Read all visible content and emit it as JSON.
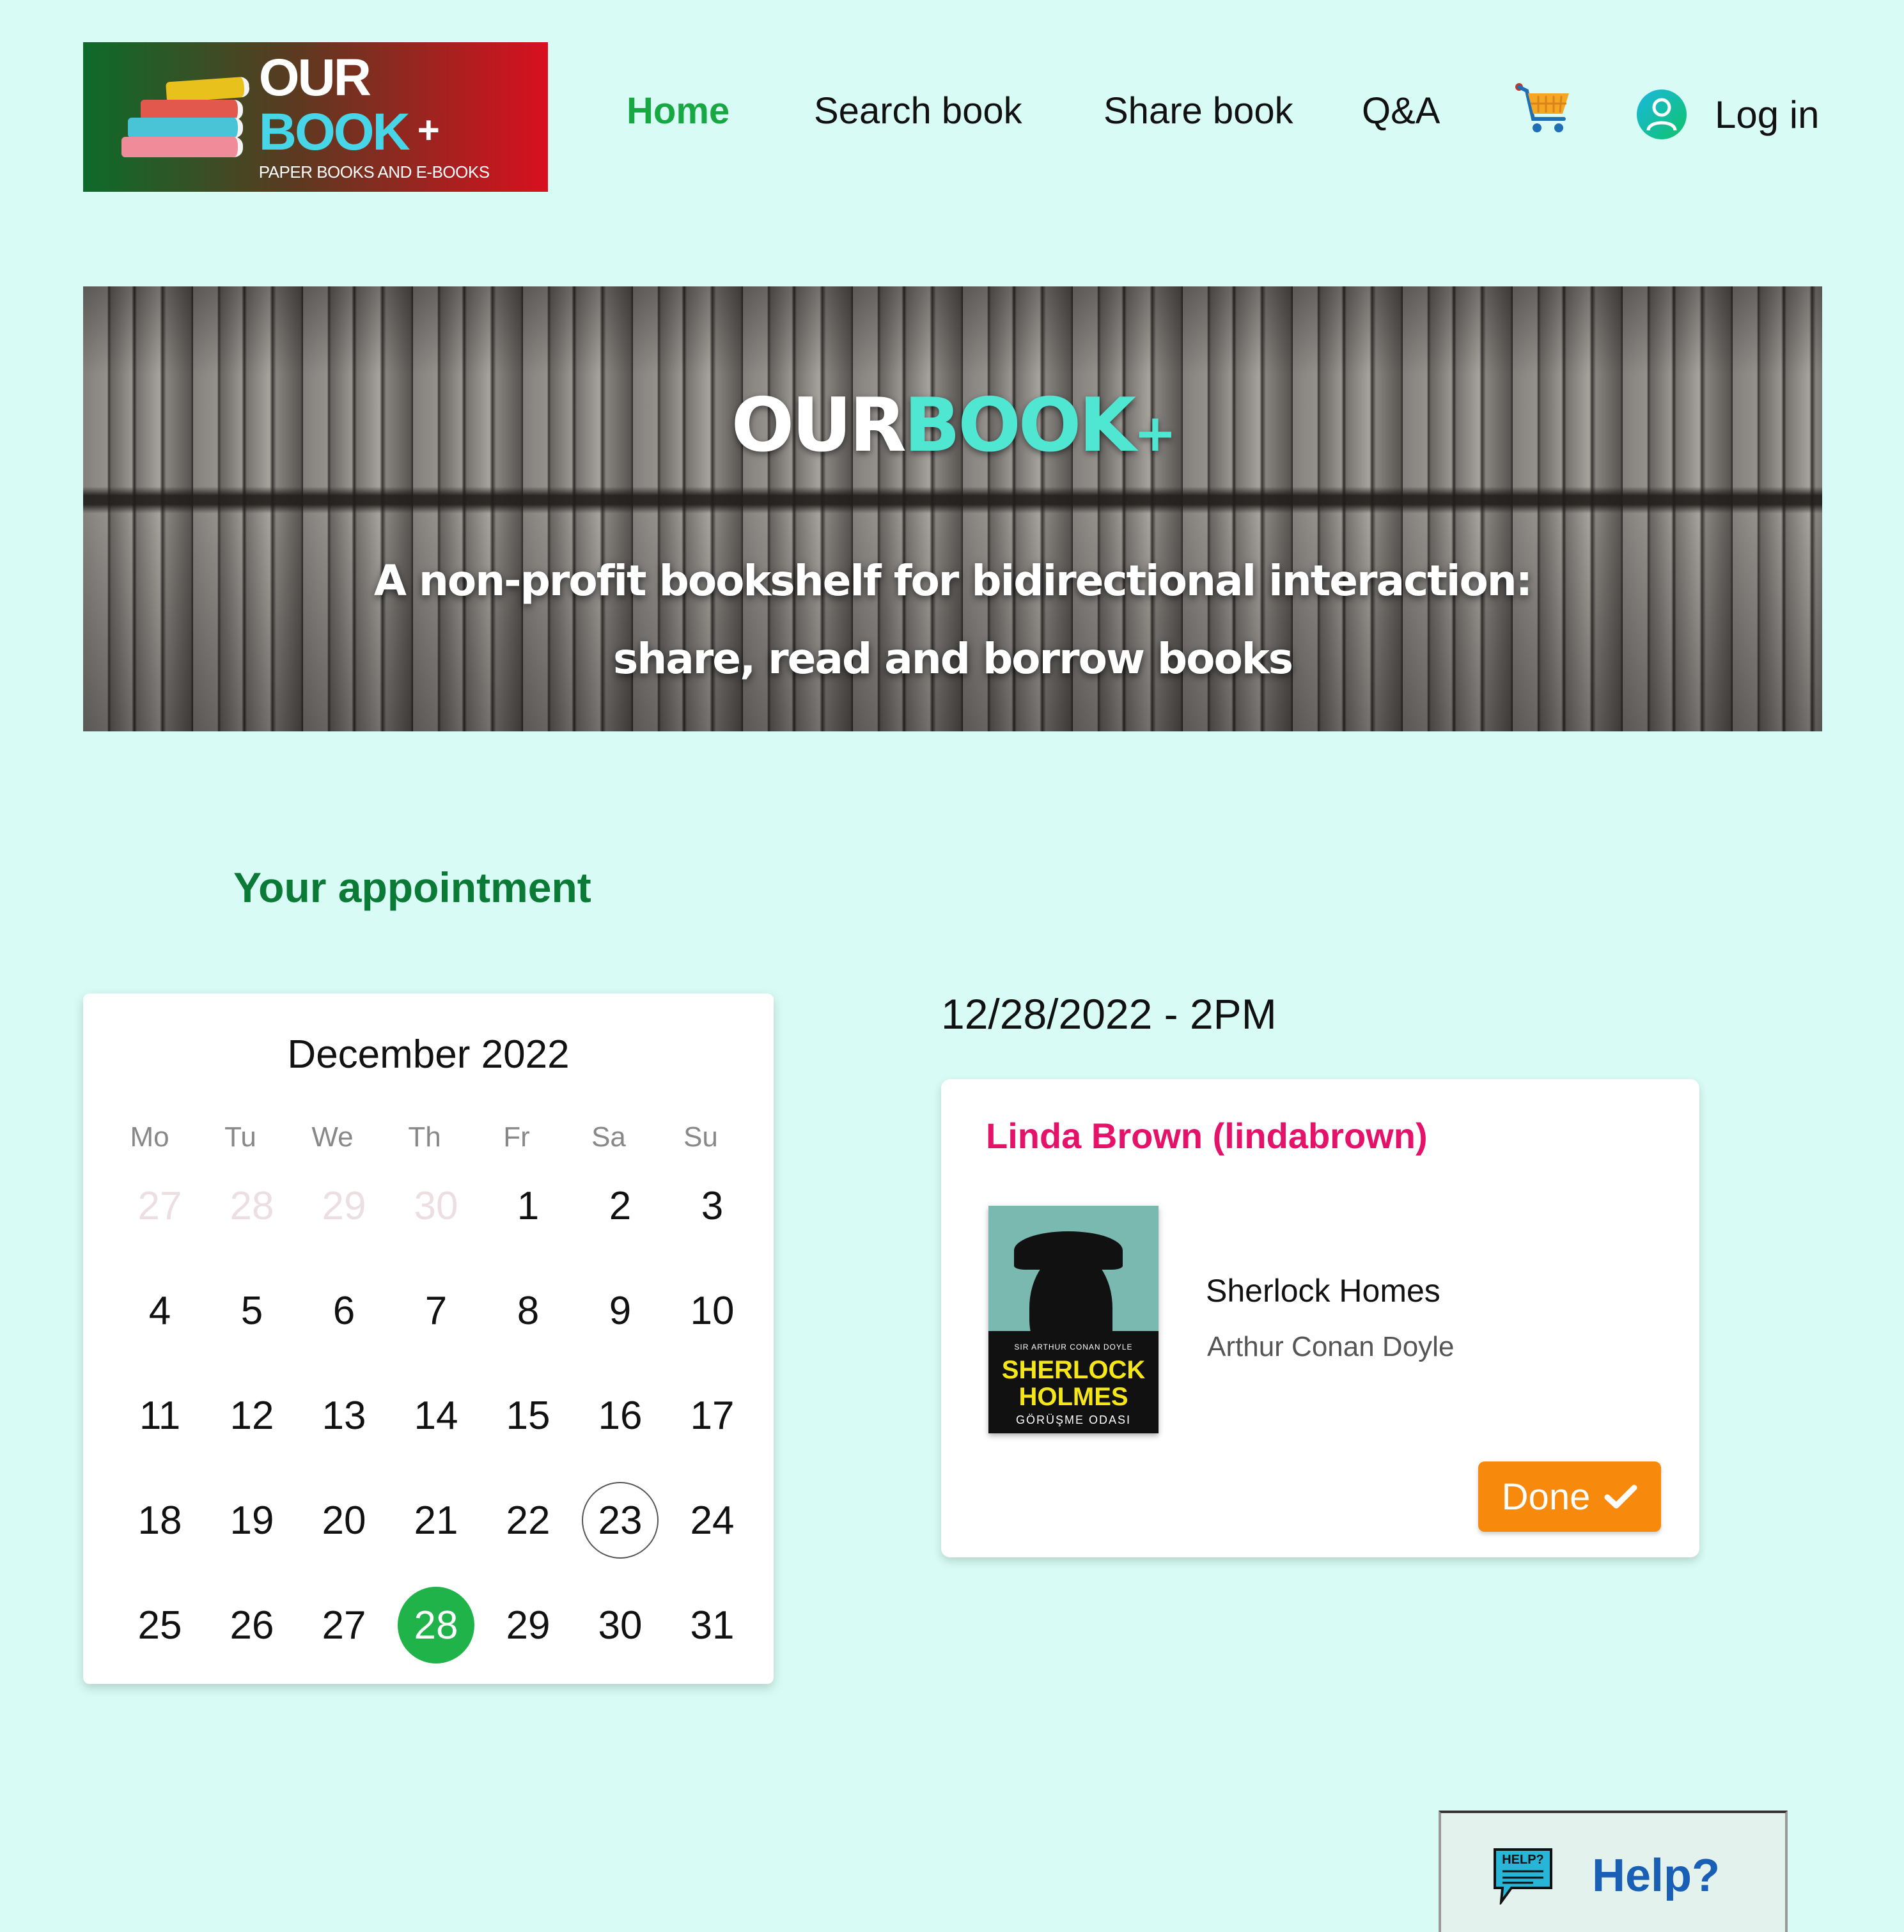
{
  "colors": {
    "background": "#d8fcf5",
    "brand_green": "#17a843",
    "heading_green": "#0a7a36",
    "accent_teal": "#4fe6d2",
    "user_pink": "#e5126a",
    "done_orange": "#f7890c",
    "help_blue": "#1a5fb6",
    "selected_day": "#1fb34a"
  },
  "logo": {
    "main_prefix": "OUR ",
    "main_accent": "BOOK",
    "plus": "+",
    "subtitle": "PAPER BOOKS AND E-BOOKS"
  },
  "nav": {
    "home": "Home",
    "search": "Search book",
    "share": "Share book",
    "qa": "Q&A",
    "cart_icon": "shopping-cart-icon",
    "login": "Log in",
    "login_icon": "user-icon"
  },
  "hero": {
    "title_prefix": "OUR",
    "title_accent": "BOOK",
    "title_plus": "+",
    "subtitle_line1": "A non-profit bookshelf for bidirectional interaction:",
    "subtitle_line2": "share, read and borrow books"
  },
  "appointment": {
    "heading": "Your appointment",
    "datetime": "12/28/2022 - 2PM"
  },
  "calendar": {
    "month_label": "December 2022",
    "weekdays": [
      "Mo",
      "Tu",
      "We",
      "Th",
      "Fr",
      "Sa",
      "Su"
    ],
    "weeks": [
      [
        {
          "d": "27",
          "m": true
        },
        {
          "d": "28",
          "m": true
        },
        {
          "d": "29",
          "m": true
        },
        {
          "d": "30",
          "m": true
        },
        {
          "d": "1"
        },
        {
          "d": "2"
        },
        {
          "d": "3"
        }
      ],
      [
        {
          "d": "4"
        },
        {
          "d": "5"
        },
        {
          "d": "6"
        },
        {
          "d": "7"
        },
        {
          "d": "8"
        },
        {
          "d": "9"
        },
        {
          "d": "10"
        }
      ],
      [
        {
          "d": "11"
        },
        {
          "d": "12"
        },
        {
          "d": "13"
        },
        {
          "d": "14"
        },
        {
          "d": "15"
        },
        {
          "d": "16"
        },
        {
          "d": "17"
        }
      ],
      [
        {
          "d": "18"
        },
        {
          "d": "19"
        },
        {
          "d": "20"
        },
        {
          "d": "21"
        },
        {
          "d": "22"
        },
        {
          "d": "23",
          "today": true
        },
        {
          "d": "24"
        }
      ],
      [
        {
          "d": "25"
        },
        {
          "d": "26"
        },
        {
          "d": "27"
        },
        {
          "d": "28",
          "selected": true
        },
        {
          "d": "29"
        },
        {
          "d": "30"
        },
        {
          "d": "31"
        }
      ]
    ]
  },
  "card": {
    "user": "Linda Brown (lindabrown)",
    "book_title": "Sherlock Homes",
    "book_author": "Arthur Conan Doyle",
    "cover": {
      "author_line": "SIR ARTHUR CONAN DOYLE",
      "title_line1": "SHERLOCK",
      "title_line2": "HOLMES",
      "subtitle": "GÖRÜŞME ODASI"
    },
    "done_label": "Done",
    "done_icon": "checkmark-icon"
  },
  "help": {
    "label": "Help?",
    "icon": "help-chat-icon",
    "icon_text": "HELP?"
  }
}
